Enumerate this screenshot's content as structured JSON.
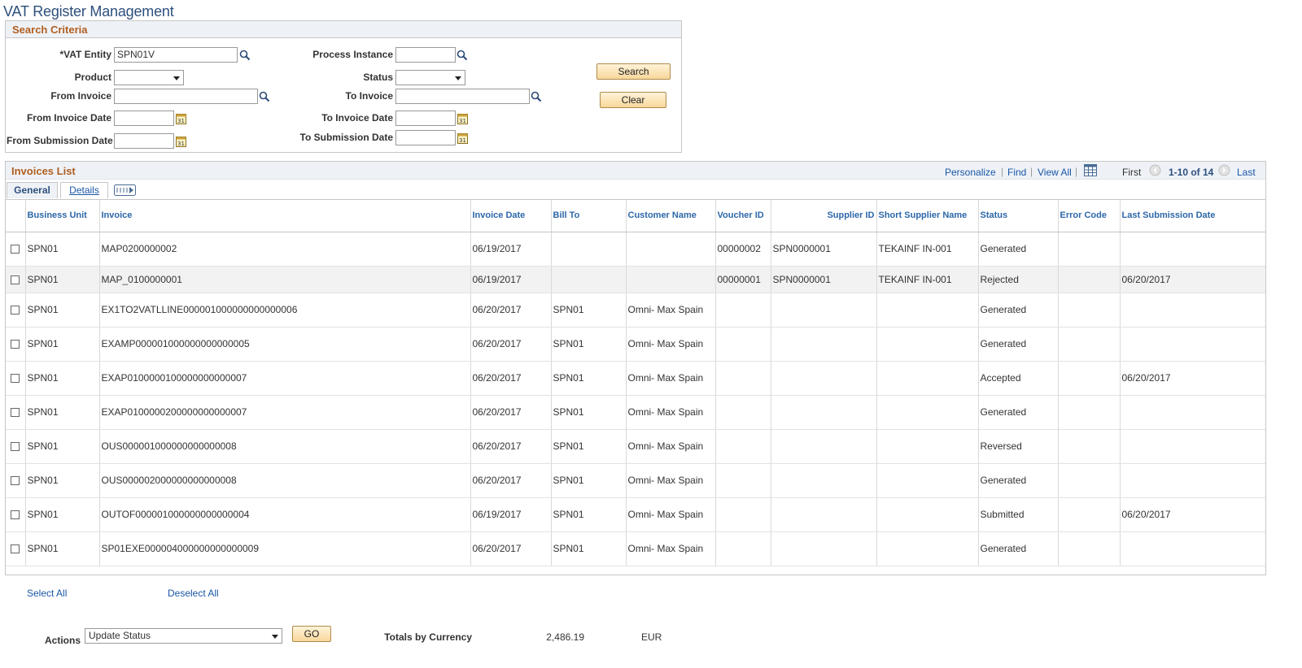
{
  "page": {
    "title": "VAT Register Management"
  },
  "search": {
    "section_title": "Search Criteria",
    "vat_entity_label": "*VAT Entity",
    "vat_entity_value": "SPN01V",
    "process_instance_label": "Process Instance",
    "process_instance_value": "",
    "product_label": "Product",
    "product_value": "",
    "status_label": "Status",
    "status_value": "",
    "from_invoice_label": "From Invoice",
    "from_invoice_value": "",
    "to_invoice_label": "To Invoice",
    "to_invoice_value": "",
    "from_invoice_date_label": "From Invoice Date",
    "from_invoice_date_value": "",
    "to_invoice_date_label": "To Invoice Date",
    "to_invoice_date_value": "",
    "from_submission_date_label": "From Submission Date",
    "from_submission_date_value": "",
    "to_submission_date_label": "To Submission Date",
    "to_submission_date_value": "",
    "search_button": "Search",
    "clear_button": "Clear"
  },
  "list": {
    "section_title": "Invoices List",
    "personalize": "Personalize",
    "find": "Find",
    "view_all": "View All",
    "first": "First",
    "range": "1-10 of 14",
    "last": "Last",
    "tabs": [
      {
        "label": "General",
        "active": true
      },
      {
        "label": "Details",
        "active": false
      }
    ],
    "columns": [
      "Business Unit",
      "Invoice",
      "Invoice Date",
      "Bill To",
      "Customer Name",
      "Voucher ID",
      "Supplier ID",
      "Short Supplier Name",
      "Status",
      "Error Code",
      "Last Submission Date"
    ],
    "rows": [
      {
        "bu": "SPN01",
        "invoice": "MAP0200000002",
        "invoice_date": "06/19/2017",
        "bill_to": "",
        "customer": "",
        "voucher": "00000002",
        "supplier": "SPN0000001",
        "short_supplier": "TEKAINF IN-001",
        "status": "Generated",
        "error": "",
        "last_sub": ""
      },
      {
        "bu": "SPN01",
        "invoice": "MAP_0100000001",
        "invoice_date": "06/19/2017",
        "bill_to": "",
        "customer": "",
        "voucher": "00000001",
        "supplier": "SPN0000001",
        "short_supplier": "TEKAINF IN-001",
        "status": "Rejected",
        "error": "",
        "last_sub": "06/20/2017"
      },
      {
        "bu": "SPN01",
        "invoice": "EX1TO2VATLLINE000001000000000000006",
        "invoice_date": "06/20/2017",
        "bill_to": "SPN01",
        "customer": "Omni- Max Spain",
        "voucher": "",
        "supplier": "",
        "short_supplier": "",
        "status": "Generated",
        "error": "",
        "last_sub": ""
      },
      {
        "bu": "SPN01",
        "invoice": "EXAMP000001000000000000005",
        "invoice_date": "06/20/2017",
        "bill_to": "SPN01",
        "customer": "Omni- Max Spain",
        "voucher": "",
        "supplier": "",
        "short_supplier": "",
        "status": "Generated",
        "error": "",
        "last_sub": ""
      },
      {
        "bu": "SPN01",
        "invoice": "EXAP0100000100000000000007",
        "invoice_date": "06/20/2017",
        "bill_to": "SPN01",
        "customer": "Omni- Max Spain",
        "voucher": "",
        "supplier": "",
        "short_supplier": "",
        "status": "Accepted",
        "error": "",
        "last_sub": "06/20/2017"
      },
      {
        "bu": "SPN01",
        "invoice": "EXAP0100000200000000000007",
        "invoice_date": "06/20/2017",
        "bill_to": "SPN01",
        "customer": "Omni- Max Spain",
        "voucher": "",
        "supplier": "",
        "short_supplier": "",
        "status": "Generated",
        "error": "",
        "last_sub": ""
      },
      {
        "bu": "SPN01",
        "invoice": "OUS000001000000000000008",
        "invoice_date": "06/20/2017",
        "bill_to": "SPN01",
        "customer": "Omni- Max Spain",
        "voucher": "",
        "supplier": "",
        "short_supplier": "",
        "status": "Reversed",
        "error": "",
        "last_sub": ""
      },
      {
        "bu": "SPN01",
        "invoice": "OUS000002000000000000008",
        "invoice_date": "06/20/2017",
        "bill_to": "SPN01",
        "customer": "Omni- Max Spain",
        "voucher": "",
        "supplier": "",
        "short_supplier": "",
        "status": "Generated",
        "error": "",
        "last_sub": ""
      },
      {
        "bu": "SPN01",
        "invoice": "OUTOF000001000000000000004",
        "invoice_date": "06/19/2017",
        "bill_to": "SPN01",
        "customer": "Omni- Max Spain",
        "voucher": "",
        "supplier": "",
        "short_supplier": "",
        "status": "Submitted",
        "error": "",
        "last_sub": "06/20/2017"
      },
      {
        "bu": "SPN01",
        "invoice": "SP01EXE000004000000000000009",
        "invoice_date": "06/20/2017",
        "bill_to": "SPN01",
        "customer": "Omni- Max Spain",
        "voucher": "",
        "supplier": "",
        "short_supplier": "",
        "status": "Generated",
        "error": "",
        "last_sub": ""
      }
    ]
  },
  "footer": {
    "select_all": "Select All",
    "deselect_all": "Deselect All",
    "actions_label": "Actions",
    "actions_value": "Update Status",
    "go_button": "GO",
    "totals_label": "Totals by Currency",
    "totals_amount": "2,486.19",
    "totals_currency": "EUR"
  },
  "icons": {
    "lookup": "magnifier-lookup-icon",
    "calendar": "calendar-icon",
    "grid_download": "spreadsheet-download-icon",
    "show_all_columns": "show-all-columns-icon"
  },
  "colors": {
    "title": "#2d4f7c",
    "section_title": "#b15e1f",
    "link": "#1a56a6",
    "header_bg": "#eef2f7",
    "button_bg": "#f8d79a"
  }
}
